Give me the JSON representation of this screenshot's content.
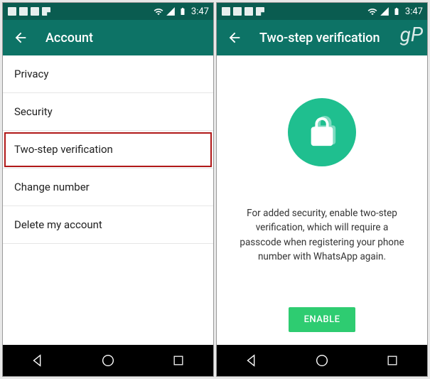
{
  "status_bar": {
    "time": "3:47"
  },
  "left_screen": {
    "title": "Account",
    "items": [
      {
        "label": "Privacy"
      },
      {
        "label": "Security"
      },
      {
        "label": "Two-step verification",
        "highlighted": true
      },
      {
        "label": "Change number"
      },
      {
        "label": "Delete my account"
      }
    ]
  },
  "right_screen": {
    "title": "Two-step verification",
    "description": "For added security, enable two-step verification, which will require a passcode when registering your phone number with WhatsApp again.",
    "enable_button": "ENABLE"
  },
  "watermark": "gP"
}
